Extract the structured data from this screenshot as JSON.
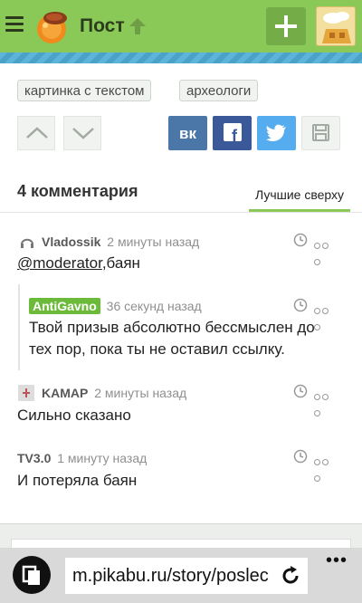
{
  "header": {
    "title": "Пост",
    "colors": {
      "bar": "#8ac858",
      "strip": "#5eb4d8",
      "plus": "#74ad48"
    }
  },
  "tags": [
    "картинка с текстом",
    "археологи"
  ],
  "share": {
    "vk": {
      "label": "вк",
      "color": "#4a76a8"
    },
    "facebook": {
      "label": "f",
      "color": "#3b5998"
    },
    "twitter": {
      "color": "#55acee"
    }
  },
  "comments_section": {
    "title": "4 комментария",
    "sort_label": "Лучшие сверху"
  },
  "comments": [
    {
      "author": "Vladossik",
      "time": "2 минуты назад",
      "mention": "@moderator",
      "text": ",баян"
    },
    {
      "author": "AntiGavno",
      "time": "36 секунд назад",
      "text": "Твой призыв абсолютно бессмыслен до тех пор, пока ты не оставил ссылку."
    },
    {
      "author": "KAMAP",
      "time": "2 минуты назад",
      "text": "Сильно сказано"
    },
    {
      "author": "TV3.0",
      "time": "1 минуту назад",
      "text": "И потеряла баян"
    }
  ],
  "browser": {
    "url": "m.pikabu.ru/story/poslec",
    "more": "•••"
  }
}
